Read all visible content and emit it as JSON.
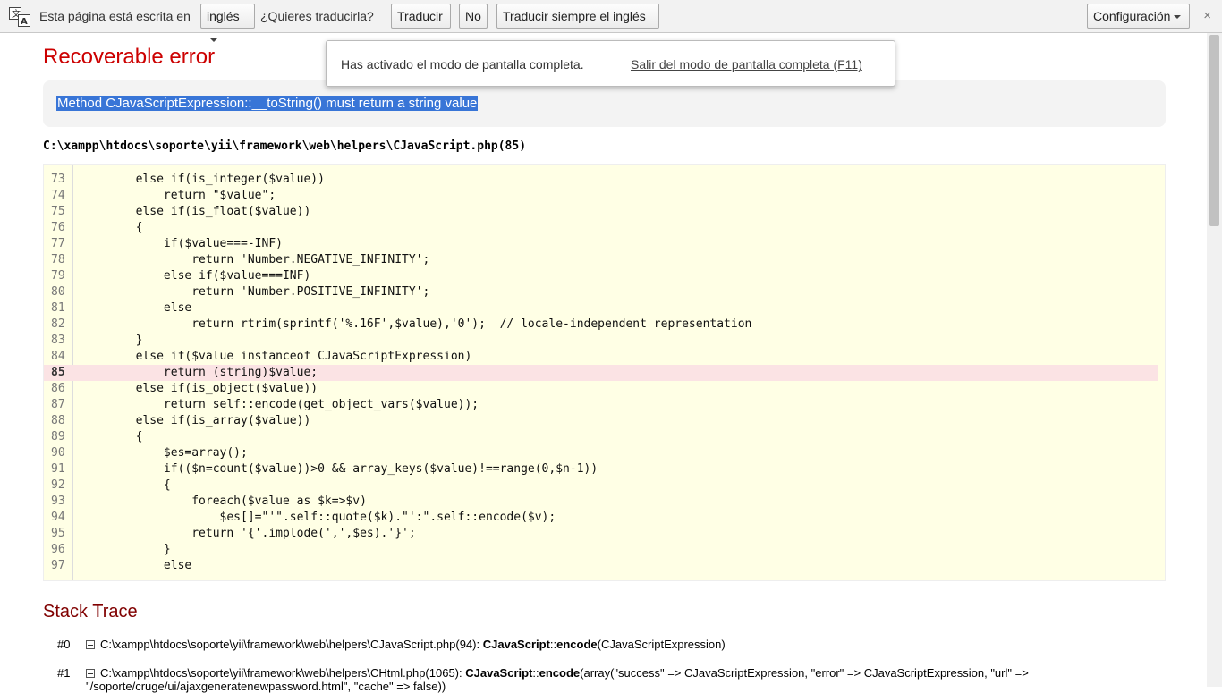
{
  "translate_bar": {
    "label_prefix": "Esta página está escrita en",
    "language": "inglés",
    "question": "¿Quieres traducirla?",
    "translate": "Traducir",
    "no": "No",
    "always": "Traducir siempre el inglés",
    "settings": "Configuración",
    "close": "×"
  },
  "fullscreen": {
    "message": "Has activado el modo de pantalla completa.",
    "exit_link": "Salir del modo de pantalla completa (F11)"
  },
  "error": {
    "title": "Recoverable error",
    "message": "Method CJavaScriptExpression::__toString() must return a string value",
    "file": "C:\\xampp\\htdocs\\soporte\\yii\\framework\\web\\helpers\\CJavaScript.php(85)"
  },
  "code": {
    "highlight_line": "85",
    "lines": [
      {
        "n": "73",
        "src": "        else if(is_integer($value))"
      },
      {
        "n": "74",
        "src": "            return \"$value\";"
      },
      {
        "n": "75",
        "src": "        else if(is_float($value))"
      },
      {
        "n": "76",
        "src": "        {"
      },
      {
        "n": "77",
        "src": "            if($value===-INF)"
      },
      {
        "n": "78",
        "src": "                return 'Number.NEGATIVE_INFINITY';"
      },
      {
        "n": "79",
        "src": "            else if($value===INF)"
      },
      {
        "n": "80",
        "src": "                return 'Number.POSITIVE_INFINITY';"
      },
      {
        "n": "81",
        "src": "            else"
      },
      {
        "n": "82",
        "src": "                return rtrim(sprintf('%.16F',$value),'0');  // locale-independent representation"
      },
      {
        "n": "83",
        "src": "        }"
      },
      {
        "n": "84",
        "src": "        else if($value instanceof CJavaScriptExpression)"
      },
      {
        "n": "85",
        "src": "            return (string)$value;"
      },
      {
        "n": "86",
        "src": "        else if(is_object($value))"
      },
      {
        "n": "87",
        "src": "            return self::encode(get_object_vars($value));"
      },
      {
        "n": "88",
        "src": "        else if(is_array($value))"
      },
      {
        "n": "89",
        "src": "        {"
      },
      {
        "n": "90",
        "src": "            $es=array();"
      },
      {
        "n": "91",
        "src": "            if(($n=count($value))>0 && array_keys($value)!==range(0,$n-1))"
      },
      {
        "n": "92",
        "src": "            {"
      },
      {
        "n": "93",
        "src": "                foreach($value as $k=>$v)"
      },
      {
        "n": "94",
        "src": "                    $es[]=\"'\".self::quote($k).\"':\".self::encode($v);"
      },
      {
        "n": "95",
        "src": "                return '{'.implode(',',$es).'}';"
      },
      {
        "n": "96",
        "src": "            }"
      },
      {
        "n": "97",
        "src": "            else"
      }
    ]
  },
  "stack": {
    "title": "Stack Trace",
    "items": [
      {
        "num": "#0",
        "path": "C:\\xampp\\htdocs\\soporte\\yii\\framework\\web\\helpers\\CJavaScript.php(94): ",
        "cls": "CJavaScript",
        "sep": "::",
        "method": "encode",
        "args": "(CJavaScriptExpression)"
      },
      {
        "num": "#1",
        "path": "C:\\xampp\\htdocs\\soporte\\yii\\framework\\web\\helpers\\CHtml.php(1065): ",
        "cls": "CJavaScript",
        "sep": "::",
        "method": "encode",
        "args": "(array(\"success\" => CJavaScriptExpression, \"error\" => CJavaScriptExpression, \"url\" =>",
        "args_cont": "\"/soporte/cruge/ui/ajaxgeneratenewpassword.html\", \"cache\" => false))"
      }
    ]
  }
}
